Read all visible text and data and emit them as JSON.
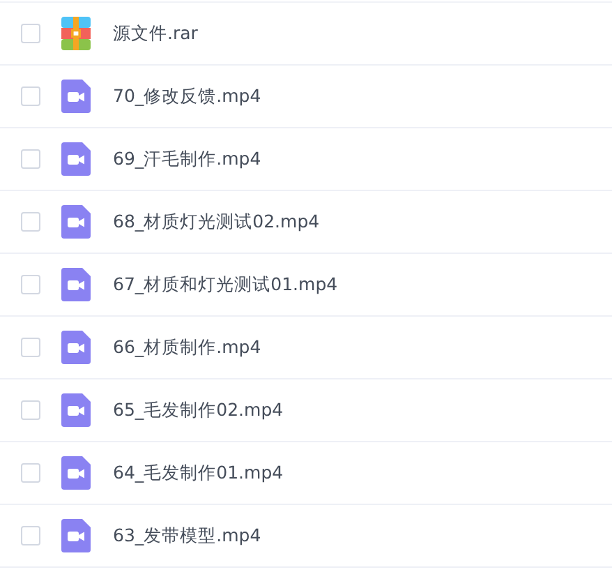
{
  "files": [
    {
      "kind": "archive",
      "name": "源文件.rar",
      "checked": false
    },
    {
      "kind": "video",
      "name": "70_修改反馈.mp4",
      "checked": false
    },
    {
      "kind": "video",
      "name": "69_汗毛制作.mp4",
      "checked": false
    },
    {
      "kind": "video",
      "name": "68_材质灯光测试02.mp4",
      "checked": false
    },
    {
      "kind": "video",
      "name": "67_材质和灯光测试01.mp4",
      "checked": false
    },
    {
      "kind": "video",
      "name": "66_材质制作.mp4",
      "checked": false
    },
    {
      "kind": "video",
      "name": "65_毛发制作02.mp4",
      "checked": false
    },
    {
      "kind": "video",
      "name": "64_毛发制作01.mp4",
      "checked": false
    },
    {
      "kind": "video",
      "name": "63_发带模型.mp4",
      "checked": false
    }
  ]
}
